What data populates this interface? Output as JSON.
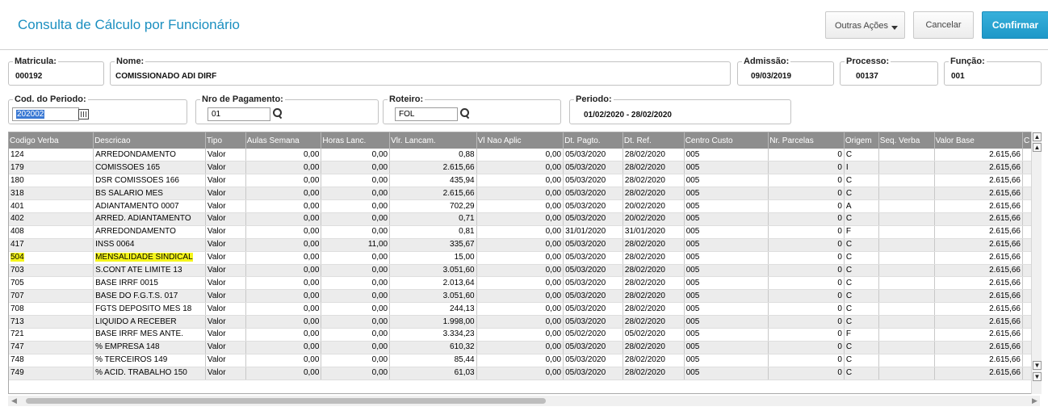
{
  "header": {
    "title": "Consulta de Cálculo por Funcionário",
    "outras_acoes": "Outras Ações",
    "cancelar": "Cancelar",
    "confirmar": "Confirmar"
  },
  "fields": {
    "matricula": {
      "label": "Matricula:",
      "value": "000192"
    },
    "nome": {
      "label": "Nome:",
      "value": "COMISSIONADO ADI DIRF"
    },
    "admissao": {
      "label": "Admissão:",
      "value": "09/03/2019"
    },
    "processo": {
      "label": "Processo:",
      "value": "00137"
    },
    "funcao": {
      "label": "Função:",
      "value": "001"
    },
    "cod_periodo": {
      "label": "Cod. do Periodo:",
      "value": "202002"
    },
    "nro_pagamento": {
      "label": "Nro de Pagamento:",
      "value": "01"
    },
    "roteiro": {
      "label": "Roteiro:",
      "value": "FOL"
    },
    "periodo": {
      "label": "Periodo:",
      "value": "01/02/2020 - 28/02/2020"
    }
  },
  "table": {
    "columns": [
      "Codigo Verba",
      "Descricao",
      "Tipo",
      "Aulas Semana",
      "Horas Lanc.",
      "Vlr. Lancam.",
      "Vl Nao Aplic",
      "Dt. Pagto.",
      "Dt. Ref.",
      "Centro Custo",
      "Nr. Parcelas",
      "Origem",
      "Seq. Verba",
      "Valor Base",
      "C"
    ],
    "rows": [
      [
        "124",
        "ARREDONDAMENTO",
        "Valor",
        "0,00",
        "0,00",
        "0,88",
        "0,00",
        "05/03/2020",
        "28/02/2020",
        "005",
        "0",
        "C",
        "",
        "2.615,66"
      ],
      [
        "179",
        "COMISSOES  165",
        "Valor",
        "0,00",
        "0,00",
        "2.615,66",
        "0,00",
        "05/03/2020",
        "28/02/2020",
        "005",
        "0",
        "I",
        "",
        "2.615,66"
      ],
      [
        "180",
        "DSR COMISSOES 166",
        "Valor",
        "0,00",
        "0,00",
        "435,94",
        "0,00",
        "05/03/2020",
        "28/02/2020",
        "005",
        "0",
        "C",
        "",
        "2.615,66"
      ],
      [
        "318",
        "BS SALARIO MES",
        "Valor",
        "0,00",
        "0,00",
        "2.615,66",
        "0,00",
        "05/03/2020",
        "28/02/2020",
        "005",
        "0",
        "C",
        "",
        "2.615,66"
      ],
      [
        "401",
        "ADIANTAMENTO 0007",
        "Valor",
        "0,00",
        "0,00",
        "702,29",
        "0,00",
        "05/03/2020",
        "20/02/2020",
        "005",
        "0",
        "A",
        "",
        "2.615,66"
      ],
      [
        "402",
        "ARRED. ADIANTAMENTO",
        "Valor",
        "0,00",
        "0,00",
        "0,71",
        "0,00",
        "05/03/2020",
        "20/02/2020",
        "005",
        "0",
        "C",
        "",
        "2.615,66"
      ],
      [
        "408",
        "ARREDONDAMENTO",
        "Valor",
        "0,00",
        "0,00",
        "0,81",
        "0,00",
        "31/01/2020",
        "31/01/2020",
        "005",
        "0",
        "F",
        "",
        "2.615,66"
      ],
      [
        "417",
        "INSS 0064",
        "Valor",
        "0,00",
        "11,00",
        "335,67",
        "0,00",
        "05/03/2020",
        "28/02/2020",
        "005",
        "0",
        "C",
        "",
        "2.615,66"
      ],
      [
        "504",
        "MENSALIDADE SINDICAL",
        "Valor",
        "0,00",
        "0,00",
        "15,00",
        "0,00",
        "05/03/2020",
        "28/02/2020",
        "005",
        "0",
        "C",
        "",
        "2.615,66"
      ],
      [
        "703",
        "S.CONT ATE LIMITE 13",
        "Valor",
        "0,00",
        "0,00",
        "3.051,60",
        "0,00",
        "05/03/2020",
        "28/02/2020",
        "005",
        "0",
        "C",
        "",
        "2.615,66"
      ],
      [
        "705",
        "BASE IRRF 0015",
        "Valor",
        "0,00",
        "0,00",
        "2.013,64",
        "0,00",
        "05/03/2020",
        "28/02/2020",
        "005",
        "0",
        "C",
        "",
        "2.615,66"
      ],
      [
        "707",
        "BASE DO F.G.T.S. 017",
        "Valor",
        "0,00",
        "0,00",
        "3.051,60",
        "0,00",
        "05/03/2020",
        "28/02/2020",
        "005",
        "0",
        "C",
        "",
        "2.615,66"
      ],
      [
        "708",
        "FGTS DEPOSITO MES 18",
        "Valor",
        "0,00",
        "0,00",
        "244,13",
        "0,00",
        "05/03/2020",
        "28/02/2020",
        "005",
        "0",
        "C",
        "",
        "2.615,66"
      ],
      [
        "713",
        "LIQUIDO A RECEBER",
        "Valor",
        "0,00",
        "0,00",
        "1.998,00",
        "0,00",
        "05/03/2020",
        "28/02/2020",
        "005",
        "0",
        "C",
        "",
        "2.615,66"
      ],
      [
        "721",
        "BASE IRRF MES ANTE.",
        "Valor",
        "0,00",
        "0,00",
        "3.334,23",
        "0,00",
        "05/02/2020",
        "05/02/2020",
        "005",
        "0",
        "F",
        "",
        "2.615,66"
      ],
      [
        "747",
        "% EMPRESA  148",
        "Valor",
        "0,00",
        "0,00",
        "610,32",
        "0,00",
        "05/03/2020",
        "28/02/2020",
        "005",
        "0",
        "C",
        "",
        "2.615,66"
      ],
      [
        "748",
        "% TERCEIROS 149",
        "Valor",
        "0,00",
        "0,00",
        "85,44",
        "0,00",
        "05/03/2020",
        "28/02/2020",
        "005",
        "0",
        "C",
        "",
        "2.615,66"
      ],
      [
        "749",
        "% ACID. TRABALHO 150",
        "Valor",
        "0,00",
        "0,00",
        "61,03",
        "0,00",
        "05/03/2020",
        "28/02/2020",
        "005",
        "0",
        "C",
        "",
        "2.615,66"
      ]
    ],
    "highlighted_row": 8
  },
  "colors": {
    "accent": "#1b8fc0",
    "confirm_bg": "#1e98c8",
    "header_bg": "#8e8e8e",
    "highlight": "#f5f51b"
  },
  "icons": {
    "search": "magnifier-icon",
    "calendar": "lookup-grid-icon"
  }
}
